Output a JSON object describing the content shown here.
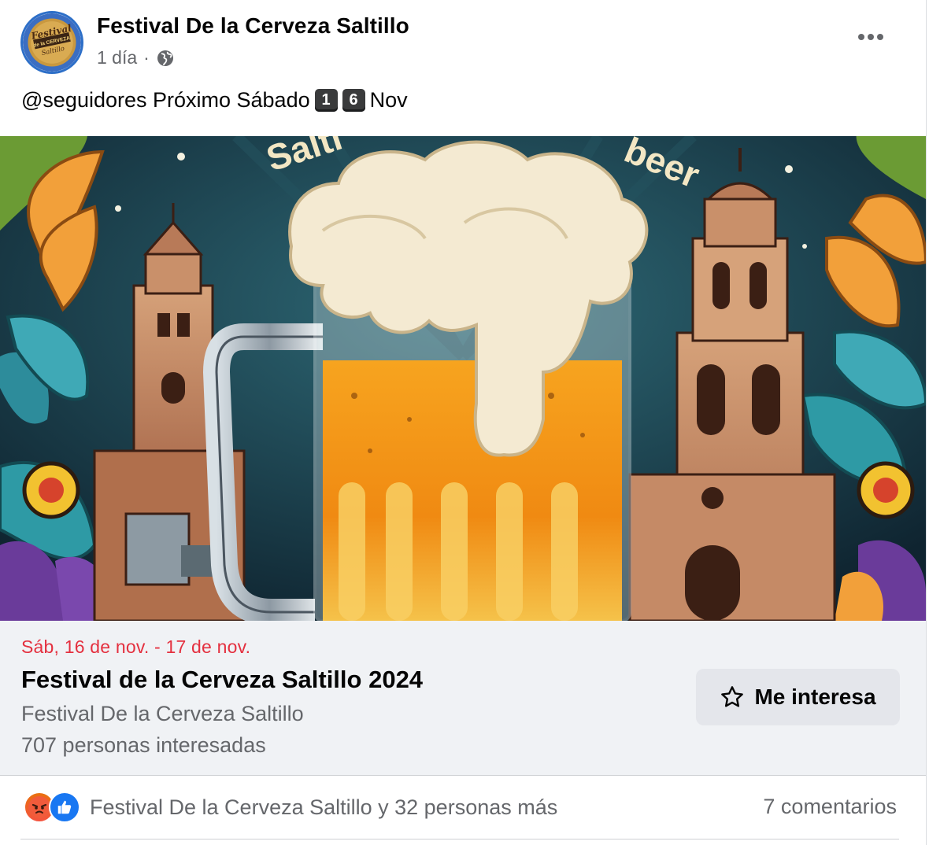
{
  "post": {
    "page_name": "Festival De la Cerveza Saltillo",
    "time": "1 día",
    "separator": "·",
    "text_prefix": "@seguidores Próximo Sábado",
    "keycap_1": "1",
    "keycap_2": "6",
    "text_suffix": "Nov",
    "avatar_logo_lines": [
      "Festival",
      "de la CERVEZA",
      "Saltillo"
    ]
  },
  "cover": {
    "visible_text_left": "Salti",
    "visible_text_right": "beer"
  },
  "event": {
    "date": "Sáb, 16 de nov. - 17 de nov.",
    "title": "Festival de la Cerveza Saltillo 2024",
    "host": "Festival De la Cerveza Saltillo",
    "interested": "707 personas interesadas",
    "interest_button": "Me interesa"
  },
  "footer": {
    "reactions_text": "Festival De la Cerveza Saltillo y 32 personas más",
    "comments": "7 comentarios"
  },
  "colors": {
    "event_date": "#e4303f",
    "secondary_text": "#65676b",
    "like_blue": "#1877f2",
    "event_bg": "#f0f2f5",
    "button_bg": "#e4e6eb"
  }
}
